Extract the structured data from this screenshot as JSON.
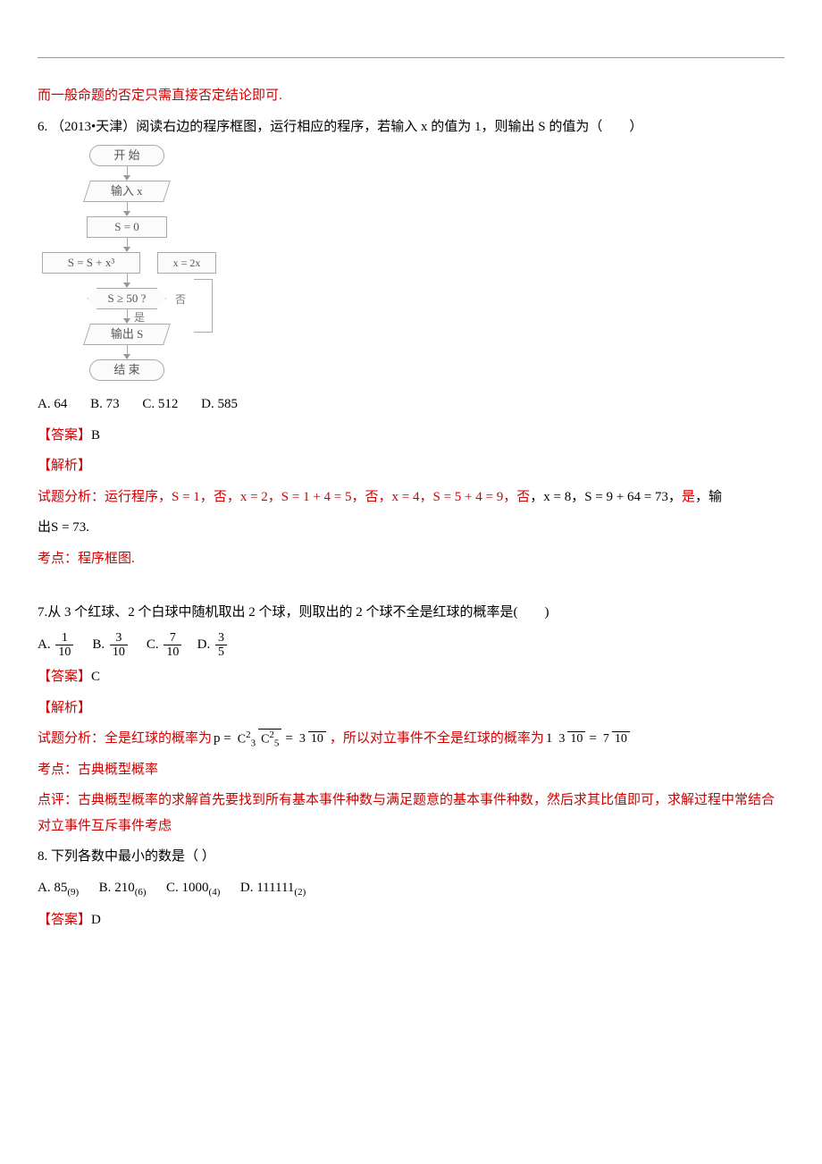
{
  "intro_red": "而一般命题的否定只需直接否定结论即可.",
  "q6": {
    "stem": "6. （2013•天津）阅读右边的程序框图，运行相应的程序，若输入 x 的值为 1，则输出 S 的值为（　　）",
    "flow": {
      "start": "开 始",
      "input": "输入 x",
      "init": "S = 0",
      "assign": "S = S + x³",
      "side": "x = 2x",
      "cond": "S ≥ 50 ?",
      "no": "否",
      "yes": "是",
      "output": "输出 S",
      "end": "结 束"
    },
    "options": {
      "a": "A. 64",
      "b": "B. 73",
      "c": "C. 512",
      "d": "D. 585"
    },
    "ans_label": "【答案】",
    "ans": "B",
    "jiexi": "【解析】",
    "analysis_pre": "试题分析：运行程序，S = 1，",
    "no1": "否",
    "seg1": "，x = 2，S = 1 + 4 = 5，",
    "no2": "否",
    "seg2": "，x = 4，S = 5 + 4 = 9，",
    "no3": "否",
    "seg3": "，x = 8，S = 9 + 64 = 73，",
    "yes_run": "是",
    "seg4": "，输",
    "line2": "出S = 73.",
    "kaodian": "考点：程序框图."
  },
  "q7": {
    "stem": "7.从 3 个红球、2 个白球中随机取出 2 个球，则取出的 2 个球不全是红球的概率是(　　)",
    "optA": "A.",
    "optB": "B.",
    "optC": "C.",
    "optD": "D.",
    "fracA": {
      "n": "1",
      "d": "10"
    },
    "fracB": {
      "n": "3",
      "d": "10"
    },
    "fracC": {
      "n": "7",
      "d": "10"
    },
    "fracD": {
      "n": "3",
      "d": "5"
    },
    "ans_label": "【答案】",
    "ans": "C",
    "jiexi": "【解析】",
    "analysis_pre": "试题分析：全是红球的概率为",
    "p_eq": "p =",
    "c32": {
      "sym": "C",
      "sup": "2",
      "sub": "3"
    },
    "c52": {
      "sym": "C",
      "sup": "2",
      "sub": "5"
    },
    "eq1": "=",
    "frac310": {
      "n": "3",
      "d": "10"
    },
    "mid": "，所以对立事件不全是红球的概率为",
    "one_minus": "1",
    "eq2": "=",
    "frac710": {
      "n": "7",
      "d": "10"
    },
    "kaodian": "考点：古典概型概率",
    "dianping": "点评：古典概型概率的求解首先要找到所有基本事件种数与满足题意的基本事件种数，然后求其比值即可，求解过程中常结合对立事件互斥事件考虑"
  },
  "q8": {
    "stem": "8. 下列各数中最小的数是（ ）",
    "a": {
      "pre": "A. ",
      "val": "85",
      "base": "(9)"
    },
    "b": {
      "pre": "B. ",
      "val": "210",
      "base": "(6)"
    },
    "c": {
      "pre": "C. ",
      "val": "1000",
      "base": "(4)"
    },
    "d": {
      "pre": "D. ",
      "val": "111111",
      "base": "(2)"
    },
    "ans_label": "【答案】",
    "ans": "D"
  }
}
